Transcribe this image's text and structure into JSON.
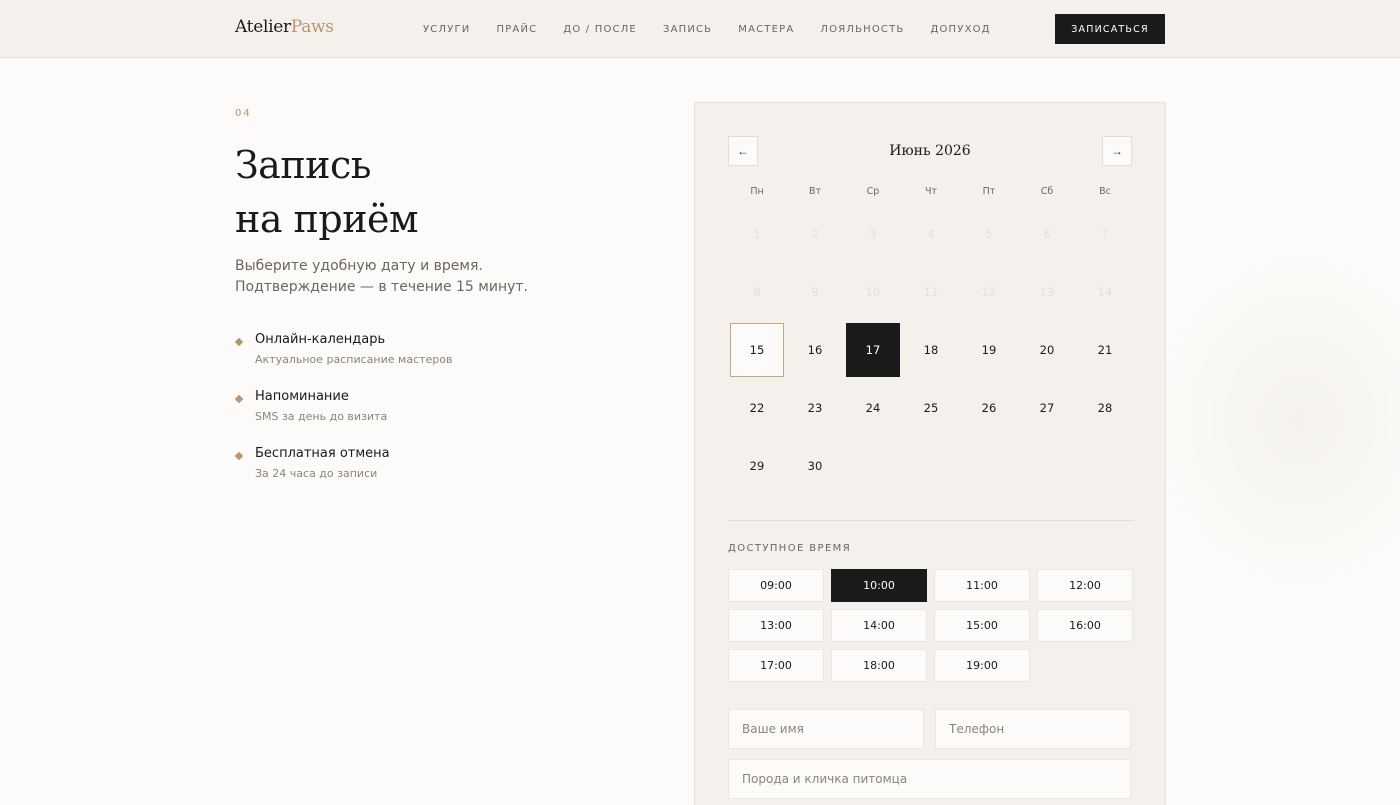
{
  "brand": {
    "name_part1": "Atelier",
    "name_part2": "Paws"
  },
  "nav": {
    "items": [
      "УСЛУГИ",
      "ПРАЙС",
      "ДО / ПОСЛЕ",
      "ЗАПИСЬ",
      "МАСТЕРА",
      "ЛОЯЛЬНОСТЬ",
      "ДОПУХОД"
    ],
    "cta_label": "ЗАПИСАТЬСЯ"
  },
  "section": {
    "number": "04",
    "title_line1": "Запись",
    "title_line2": "на приём",
    "lead": "Выберите удобную дату и время. Подтверждение — в течение 15 минут."
  },
  "features": [
    {
      "title": "Онлайн-календарь",
      "subtitle": "Актуальное расписание мастеров"
    },
    {
      "title": "Напоминание",
      "subtitle": "SMS за день до визита"
    },
    {
      "title": "Бесплатная отмена",
      "subtitle": "За 24 часа до записи"
    }
  ],
  "calendar": {
    "month_label": "Июнь 2026",
    "prev_icon": "arrow-left-icon",
    "next_icon": "arrow-right-icon",
    "weekdays": [
      "Пн",
      "Вт",
      "Ср",
      "Чт",
      "Пт",
      "Сб",
      "Вс"
    ],
    "days": [
      "1",
      "2",
      "3",
      "4",
      "5",
      "6",
      "7",
      "8",
      "9",
      "10",
      "11",
      "12",
      "13",
      "14",
      "15",
      "16",
      "17",
      "18",
      "19",
      "20",
      "21",
      "22",
      "23",
      "24",
      "25",
      "26",
      "27",
      "28",
      "29",
      "30"
    ],
    "first_weekday_offset": 0,
    "today": "15",
    "selected": "17",
    "past_days_through": 14
  },
  "time": {
    "title": "ДОСТУПНОЕ ВРЕМЯ",
    "slots": [
      "09:00",
      "10:00",
      "11:00",
      "12:00",
      "13:00",
      "14:00",
      "15:00",
      "16:00",
      "17:00",
      "18:00",
      "19:00"
    ],
    "selected": "10:00"
  },
  "form": {
    "name_placeholder": "Ваше имя",
    "phone_placeholder": "Телефон",
    "pet_placeholder": "Порода и кличка питомца"
  },
  "colors": {
    "accent": "#b8956a",
    "dark": "#1a1a1a",
    "panel": "#f4f1ec",
    "background": "#fcfbf9"
  }
}
